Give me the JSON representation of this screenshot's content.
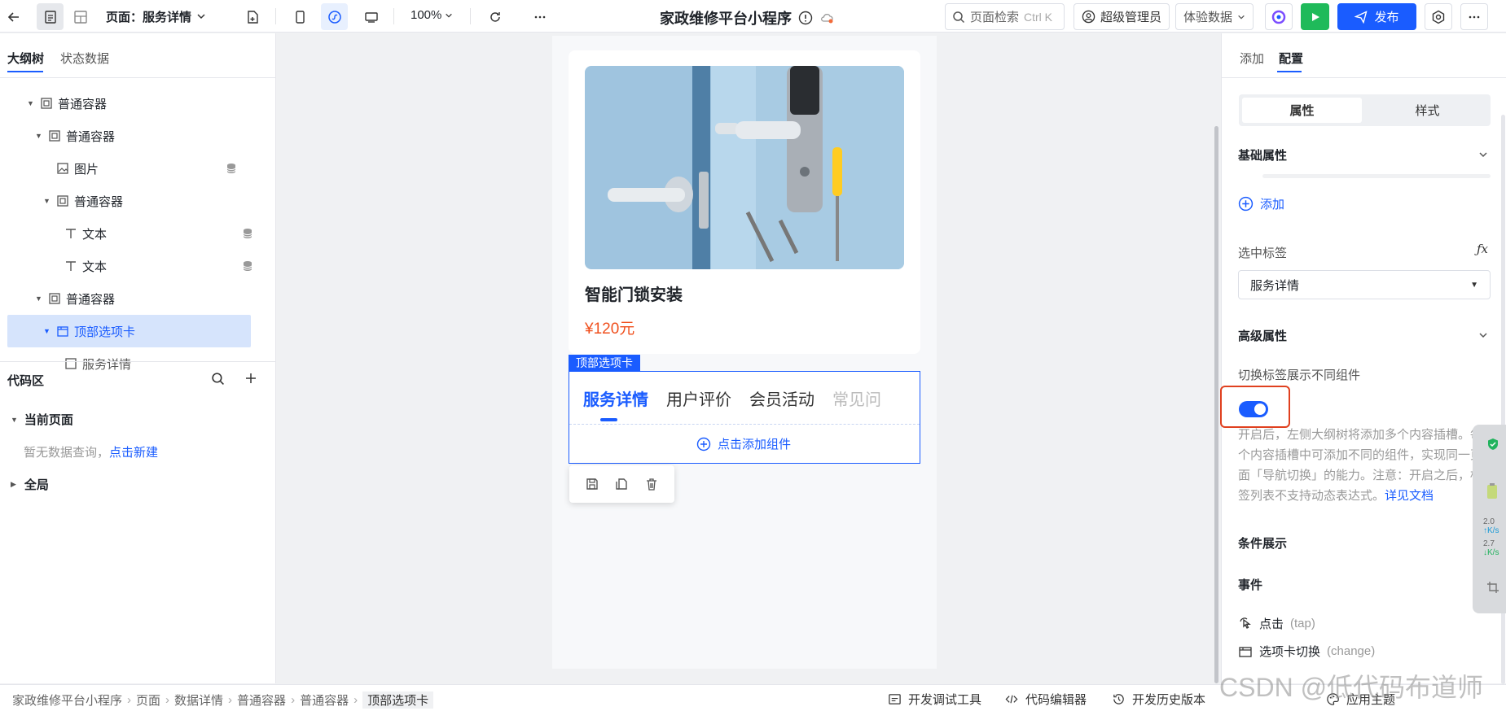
{
  "topbar": {
    "page_label": "页面：服务详情",
    "zoom": "100%",
    "app_title": "家政维修平台小程序",
    "search_label": "页面检索",
    "search_shortcut": "Ctrl K",
    "admin_label": "超级管理员",
    "data_mode": "体验数据",
    "publish_label": "发布"
  },
  "left": {
    "tab_outline": "大纲树",
    "tab_state": "状态数据",
    "tree": [
      {
        "label": "普通容器"
      },
      {
        "label": "普通容器"
      },
      {
        "label": "图片"
      },
      {
        "label": "普通容器"
      },
      {
        "label": "文本"
      },
      {
        "label": "文本"
      },
      {
        "label": "普通容器"
      },
      {
        "label": "顶部选项卡"
      },
      {
        "label": "服务详情"
      }
    ],
    "code_title": "代码区",
    "current_page": "当前页面",
    "empty_text": "暂无数据查询，",
    "create_link": "点击新建",
    "global": "全局"
  },
  "canvas": {
    "product_name": "智能门锁安装",
    "price": "¥120元",
    "tab_component_label": "顶部选项卡",
    "tabs": [
      "服务详情",
      "用户评价",
      "会员活动",
      "常见问"
    ],
    "add_component": "点击添加组件"
  },
  "right": {
    "tab_add": "添加",
    "tab_config": "配置",
    "seg_props": "属性",
    "seg_style": "样式",
    "basic_props": "基础属性",
    "add_label": "添加",
    "selected_tab_label": "选中标签",
    "selected_tab_value": "服务详情",
    "advanced_props": "高级属性",
    "switch_label": "切换标签展示不同组件",
    "switch_on": true,
    "help_text": "开启后，左侧大纲树将添加多个内容插槽。每个内容插槽中可添加不同的组件，实现同一页面「导航切换」的能力。注意：开启之后，标签列表不支持动态表达式。",
    "help_link": "详见文档",
    "condition_show": "条件展示",
    "events": "事件",
    "event_click": "点击",
    "event_click_en": "(tap)",
    "event_change": "选项卡切换",
    "event_change_en": "(change)"
  },
  "statusbar": {
    "breadcrumb": [
      "家政维修平台小程序",
      "页面",
      "数据详情",
      "普通容器",
      "普通容器",
      "顶部选项卡"
    ],
    "debug_tool": "开发调试工具",
    "code_editor": "代码编辑器",
    "history": "开发历史版本",
    "theme": "应用主题"
  },
  "side_widget": {
    "up_speed": "2.0",
    "up_unit": "K/s",
    "down_speed": "2.7",
    "down_unit": "K/s"
  },
  "watermark": "CSDN @低代码布道师",
  "colors": {
    "accent": "#1a5cff",
    "price": "#f0501e",
    "play": "#1fba5a",
    "highlight_border": "#e0401f"
  }
}
